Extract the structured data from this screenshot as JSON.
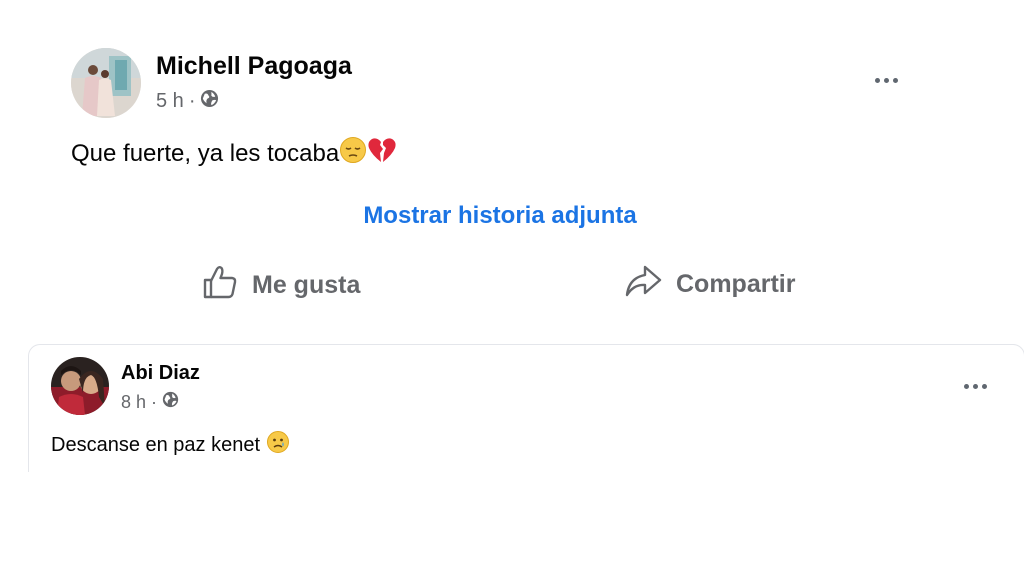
{
  "post1": {
    "author": "Michell Pagoaga",
    "time": "5 h",
    "separator": "·",
    "text": "Que fuerte, ya les tocaba",
    "show_story": "Mostrar historia adjunta",
    "actions": {
      "like": "Me gusta",
      "share": "Compartir"
    }
  },
  "post2": {
    "author": "Abi Diaz",
    "time": "8 h",
    "separator": "·",
    "text": "Descanse en paz kenet"
  },
  "icons": {
    "globe": "globe-icon",
    "more": "more-options-icon",
    "like": "thumbs-up-icon",
    "share": "share-arrow-icon"
  },
  "colors": {
    "link": "#1b74e4",
    "secondary": "#65676b",
    "text": "#050505"
  }
}
